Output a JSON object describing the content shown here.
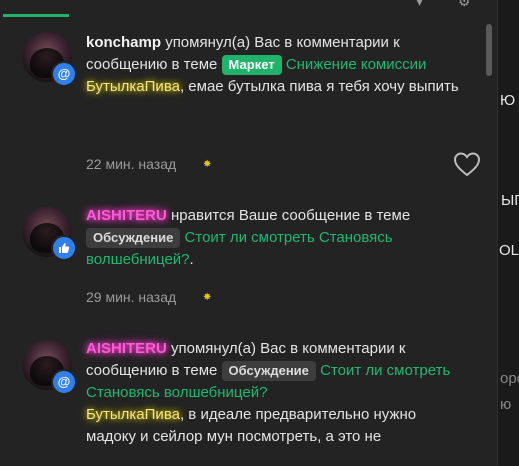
{
  "background_fragments": [
    {
      "text": "Ю",
      "color": "#1fb36b"
    },
    {
      "text": "ЫП",
      "color": "#1fb36b"
    },
    {
      "text": "OLA",
      "color": "#1fb36b"
    },
    {
      "text": "оро",
      "color": "#888888"
    },
    {
      "text": "ю",
      "color": "#888888"
    }
  ],
  "notifications": [
    {
      "user": "konchamp",
      "action": "упомянул(а) Вас в комментарии к сообщению в теме",
      "tag": "Маркет",
      "topic": "Снижение комиссии",
      "quote_user": "БутылкаПива",
      "quote_text": ", емае бутылка пива я тебя хочу выпить",
      "time": "22 мин. назад",
      "badge_icon": "at-icon"
    },
    {
      "user": "AISHITERU",
      "action": "нравится Ваше сообщение в теме",
      "tag": "Обсуждение",
      "topic": "Стоит ли смотреть Становясь волшебницей?",
      "period": ".",
      "time": "29 мин. назад",
      "badge_icon": "thumbs-up-icon"
    },
    {
      "user": "AISHITERU",
      "action": "упомянул(а) Вас в комментарии к сообщению в теме",
      "tag": "Обсуждение",
      "topic": "Стоит ли смотреть Становясь волшебницей?",
      "quote_user": "БутылкаПива",
      "quote_text": ", в идеале предварительно нужно мадоку и сейлор мун посмотреть, а это не",
      "badge_icon": "at-icon"
    }
  ]
}
